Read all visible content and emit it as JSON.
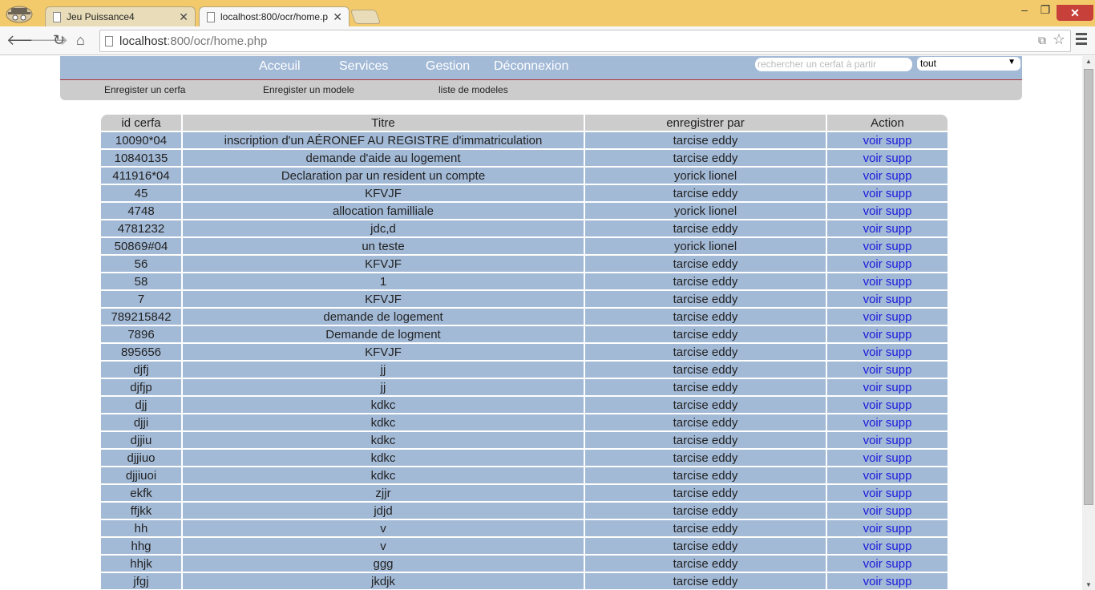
{
  "browser": {
    "tabs": [
      {
        "title": "Jeu Puissance4"
      },
      {
        "title": "localhost:800/ocr/home.p"
      }
    ],
    "url_host": "localhost",
    "url_rest": ":800/ocr/home.php",
    "icons": {
      "back": "arrow-left-icon",
      "forward": "arrow-right-icon",
      "reload": "reload-icon",
      "home": "home-icon",
      "star": "star-icon",
      "menu": "hamburger-icon"
    }
  },
  "nav": {
    "main": [
      "Acceuil",
      "Services",
      "Gestion",
      "Déconnexion"
    ],
    "search_placeholder": "rechercher  un cerfat à partir",
    "filter_value": "tout",
    "sub": [
      "Enregister un cerfa",
      "Enregister un modele",
      "liste de modeles"
    ]
  },
  "table": {
    "headers": [
      "id cerfa",
      "Titre",
      "enregistrer par",
      "Action"
    ],
    "action_view": "voir",
    "action_delete": "supp",
    "rows": [
      [
        "10090*04",
        "inscription d'un AÉRONEF AU REGISTRE d'immatriculation",
        "tarcise eddy"
      ],
      [
        "10840135",
        "demande d'aide au logement",
        "tarcise eddy"
      ],
      [
        "411916*04",
        "Declaration par un resident un compte",
        "yorick lionel"
      ],
      [
        "45",
        "KFVJF",
        "tarcise eddy"
      ],
      [
        "4748",
        "allocation familliale",
        "yorick lionel"
      ],
      [
        "4781232",
        "jdc,d",
        "tarcise eddy"
      ],
      [
        "50869#04",
        "un teste",
        "yorick lionel"
      ],
      [
        "56",
        "KFVJF",
        "tarcise eddy"
      ],
      [
        "58",
        "1",
        "tarcise eddy"
      ],
      [
        "7",
        "KFVJF",
        "tarcise eddy"
      ],
      [
        "789215842",
        "demande de logement",
        "tarcise eddy"
      ],
      [
        "7896",
        "Demande de logment",
        "tarcise eddy"
      ],
      [
        "895656",
        "KFVJF",
        "tarcise eddy"
      ],
      [
        "djfj",
        "jj",
        "tarcise eddy"
      ],
      [
        "djfjp",
        "jj",
        "tarcise eddy"
      ],
      [
        "djj",
        "kdkc",
        "tarcise eddy"
      ],
      [
        "djji",
        "kdkc",
        "tarcise eddy"
      ],
      [
        "djjiu",
        "kdkc",
        "tarcise eddy"
      ],
      [
        "djjiuo",
        "kdkc",
        "tarcise eddy"
      ],
      [
        "djjiuoi",
        "kdkc",
        "tarcise eddy"
      ],
      [
        "ekfk",
        "zjjr",
        "tarcise eddy"
      ],
      [
        "ffjkk",
        "jdjd",
        "tarcise eddy"
      ],
      [
        "hh",
        "v",
        "tarcise eddy"
      ],
      [
        "hhg",
        "v",
        "tarcise eddy"
      ],
      [
        "hhjk",
        "ggg",
        "tarcise eddy"
      ],
      [
        "jfgj",
        "jkdjk",
        "tarcise eddy"
      ]
    ]
  }
}
